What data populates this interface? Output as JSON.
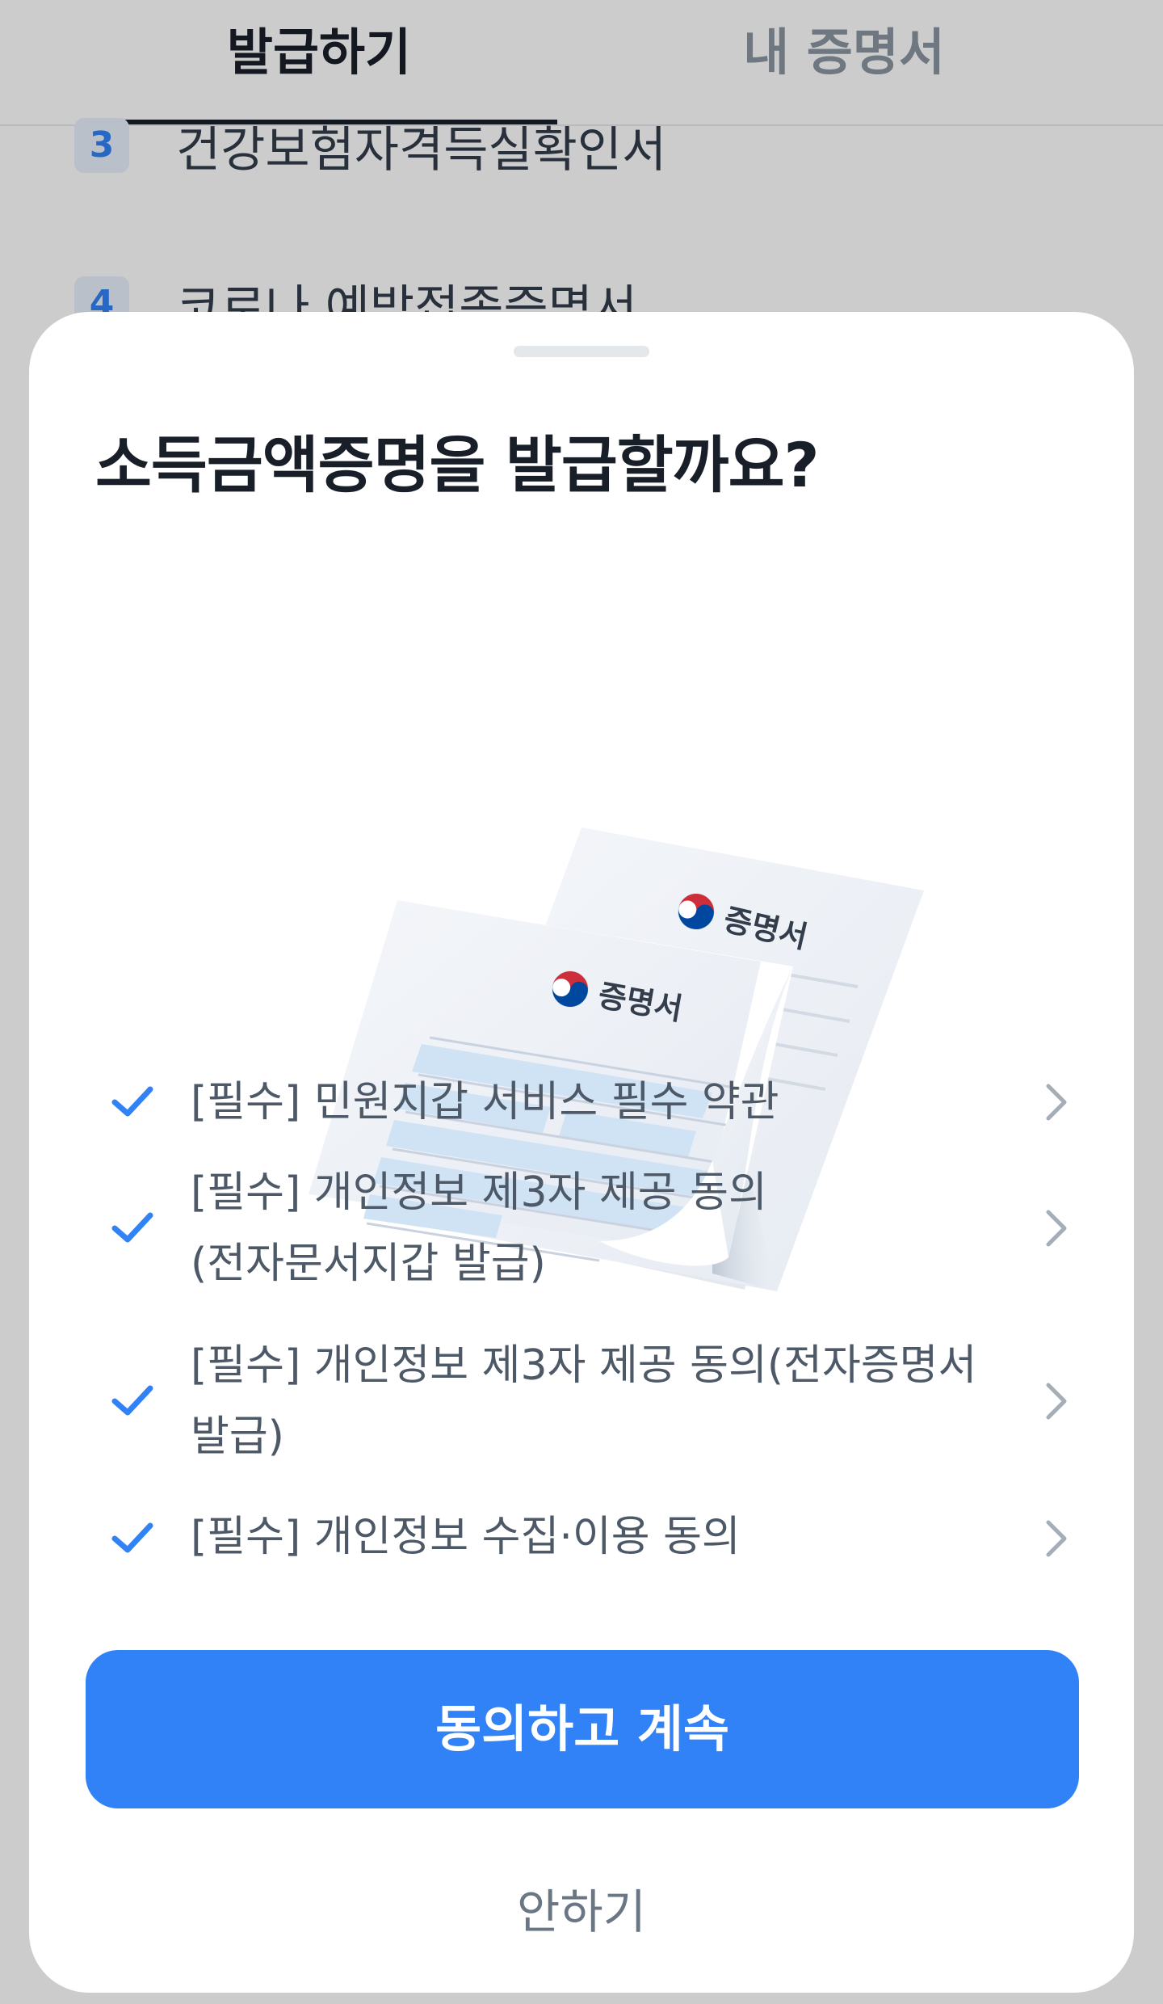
{
  "tabs": [
    {
      "label": "발급하기",
      "active": true
    },
    {
      "label": "내 증명서",
      "active": false
    }
  ],
  "background_list": [
    {
      "number": "3",
      "label": "건강보험자격득실확인서"
    },
    {
      "number": "4",
      "label": "코로나 예방접종증명서"
    }
  ],
  "sheet": {
    "title": "소득금액증명을 발급할까요?",
    "illustration": {
      "front_doc_label": "증명서",
      "back_doc_label": "증명서"
    },
    "agreements": [
      {
        "label": "[필수] 민원지갑 서비스 필수 약관",
        "checked": true
      },
      {
        "label": "[필수] 개인정보 제3자 제공 동의(전자문서지갑 발급)",
        "checked": true
      },
      {
        "label": "[필수] 개인정보 제3자 제공 동의(전자증명서 발급)",
        "checked": true
      },
      {
        "label": "[필수] 개인정보 수집·이용 동의",
        "checked": true
      }
    ],
    "primary_button": "동의하고 계속",
    "secondary_button": "안하기"
  },
  "colors": {
    "accent": "#3182f6",
    "title": "#191f28",
    "body_text": "#4e5968",
    "muted": "#8b95a1"
  }
}
